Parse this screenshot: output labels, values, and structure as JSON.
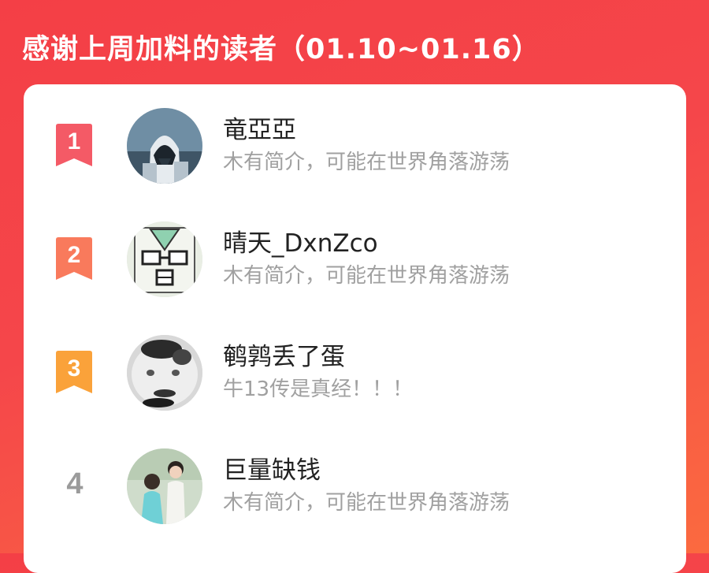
{
  "header": {
    "title": "感谢上周加料的读者（01.10~01.16）"
  },
  "readers": [
    {
      "rank": "1",
      "name": "竜亞亞",
      "bio": "木有简介，可能在世界角落游荡",
      "rank_color": "#f45a66",
      "avatar": "assassin-avatar"
    },
    {
      "rank": "2",
      "name": "晴天_DxnZco",
      "bio": "木有简介，可能在世界角落游荡",
      "rank_color": "#f97a5c",
      "avatar": "cartoon-face-avatar"
    },
    {
      "rank": "3",
      "name": "鹌鹑丢了蛋",
      "bio": "牛13传是真经！！！",
      "rank_color": "#faa23a",
      "avatar": "blurry-face-avatar"
    },
    {
      "rank": "4",
      "name": "巨量缺钱",
      "bio": "木有简介，可能在世界角落游荡",
      "rank_color": "#9b9b9b",
      "avatar": "couple-photo-avatar"
    }
  ]
}
